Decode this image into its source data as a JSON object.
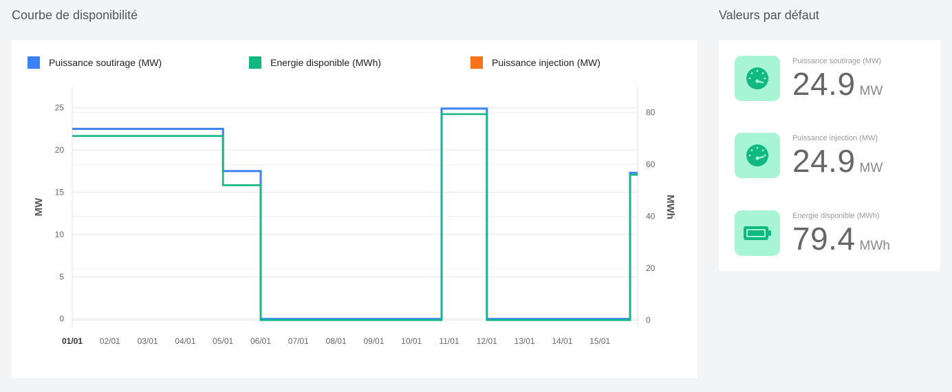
{
  "left_title": "Courbe de disponibilité",
  "right_title": "Valeurs par défaut",
  "colors": {
    "soutirage": "#3b82f6",
    "energie": "#10b981",
    "injection": "#f97316",
    "icon_bg": "#a8f5d5",
    "icon_fg": "#10b981"
  },
  "legend": [
    {
      "label": "Puissance soutirage (MW)",
      "color": "#3b82f6"
    },
    {
      "label": "Energie disponible (MWh)",
      "color": "#10b981"
    },
    {
      "label": "Puissance injection (MW)",
      "color": "#f97316"
    }
  ],
  "chart_data": {
    "type": "line",
    "step": true,
    "x_ticks": [
      "01/01",
      "02/01",
      "03/01",
      "04/01",
      "05/01",
      "06/01",
      "07/01",
      "08/01",
      "09/01",
      "10/01",
      "11/01",
      "12/01",
      "13/01",
      "14/01",
      "15/01"
    ],
    "x_range": [
      0,
      15
    ],
    "y_left": {
      "label": "MW",
      "ticks": [
        0,
        5,
        10,
        15,
        20,
        25
      ],
      "range": [
        -1,
        27.5
      ]
    },
    "y_right": {
      "label": "MWh",
      "ticks": [
        0,
        20,
        40,
        60,
        80
      ],
      "range": [
        -2.8,
        90
      ]
    },
    "grid": true,
    "legend_position": "top",
    "series": [
      {
        "name": "Puissance soutirage (MW)",
        "axis": "left",
        "color": "#3b82f6",
        "points": [
          [
            0,
            22.5
          ],
          [
            4,
            22.5
          ],
          [
            4,
            17.5
          ],
          [
            5,
            17.5
          ],
          [
            5,
            0
          ],
          [
            9.8,
            0
          ],
          [
            9.8,
            24.9
          ],
          [
            11,
            24.9
          ],
          [
            11,
            0
          ],
          [
            14.8,
            0
          ],
          [
            14.8,
            17.3
          ],
          [
            15,
            17.3
          ]
        ]
      },
      {
        "name": "Energie disponible (MWh)",
        "axis": "right",
        "color": "#10b981",
        "points": [
          [
            0,
            71
          ],
          [
            4,
            71
          ],
          [
            4,
            52
          ],
          [
            5,
            52
          ],
          [
            5,
            0
          ],
          [
            9.8,
            0
          ],
          [
            9.8,
            79.4
          ],
          [
            11,
            79.4
          ],
          [
            11,
            0
          ],
          [
            14.8,
            0
          ],
          [
            14.8,
            56
          ],
          [
            15,
            56
          ]
        ]
      }
    ]
  },
  "kpis": [
    {
      "label": "Puissance soutirage (MW)",
      "value": "24.9",
      "unit": "MW",
      "icon": "gauge-icon"
    },
    {
      "label": "Puissance injection (MW)",
      "value": "24.9",
      "unit": "MW",
      "icon": "gauge-icon"
    },
    {
      "label": "Energie disponible (MWh)",
      "value": "79.4",
      "unit": "MWh",
      "icon": "battery-icon"
    }
  ]
}
